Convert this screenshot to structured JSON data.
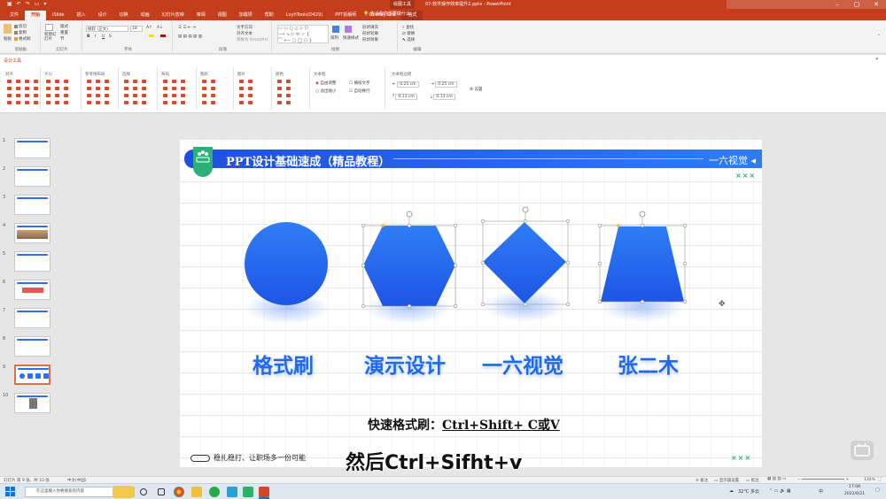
{
  "titlebar": {
    "context_tool": "绘图工具",
    "doc_title": "07-软件操作效率提升2.pptx  -  PowerPoint",
    "window_controls": [
      "minimize-icon",
      "restore-icon",
      "close-icon"
    ]
  },
  "tabs": [
    {
      "label": "文件",
      "active": false
    },
    {
      "label": "开始",
      "active": true
    },
    {
      "label": "iSlide",
      "active": false
    },
    {
      "label": "插入",
      "active": false
    },
    {
      "label": "设计",
      "active": false
    },
    {
      "label": "切换",
      "active": false
    },
    {
      "label": "动画",
      "active": false
    },
    {
      "label": "幻灯片放映",
      "active": false
    },
    {
      "label": "审阅",
      "active": false
    },
    {
      "label": "视图",
      "active": false
    },
    {
      "label": "加载项",
      "active": false
    },
    {
      "label": "帮助",
      "active": false
    },
    {
      "label": "LvyhTools(D429)",
      "active": false
    },
    {
      "label": "PPT拆解师",
      "active": false
    },
    {
      "label": "OneKey Lite",
      "active": false
    },
    {
      "label": "格式",
      "active": false,
      "contextual": true
    }
  ],
  "tell_me": "告诉我你想要做什么",
  "ribbon": {
    "clipboard": {
      "label": "剪贴板",
      "paste": "粘贴",
      "cut": "剪切",
      "copy": "复制",
      "format_painter": "格式刷"
    },
    "slides": {
      "label": "幻灯片",
      "new_slide": "新建幻灯片",
      "layout": "版式",
      "reset": "重置",
      "section": "节"
    },
    "font": {
      "label": "字体",
      "font_name": "微软 (正文)",
      "font_size": "18",
      "bold": "B",
      "italic": "I",
      "underline": "U",
      "strike": "S"
    },
    "paragraph": {
      "label": "段落",
      "text_direction": "文字方向",
      "align_text": "对齐文本",
      "smartart": "转换为 SmartArt"
    },
    "drawing": {
      "label": "绘图",
      "arrange": "排列",
      "quick_styles": "快速样式",
      "shape_fill": "形状填充",
      "shape_outline": "形状轮廓",
      "shape_effects": "形状效果"
    },
    "editing": {
      "label": "编辑",
      "find": "查找",
      "replace": "替换",
      "select": "选择"
    }
  },
  "design_pane": {
    "title": "设计工具",
    "groups": [
      {
        "title": "对齐"
      },
      {
        "title": "大小"
      },
      {
        "title": "参考线布局"
      },
      {
        "title": "选择"
      },
      {
        "title": "布局"
      },
      {
        "title": "图形"
      },
      {
        "title": "图片"
      },
      {
        "title": "颜色"
      }
    ],
    "text_group": {
      "title": "文本框",
      "autofit": "自由调整",
      "overflow": "溢出缩小",
      "vertical": "横排文字",
      "wrap": "自动换行"
    },
    "margins": {
      "title": "文本框边距",
      "left": "0.25 cm",
      "right": "0.25 cm",
      "top": "0.13 cm",
      "bottom": "0.13 cm",
      "settings": "设置"
    }
  },
  "thumbnails": [
    {
      "num": "1"
    },
    {
      "num": "2"
    },
    {
      "num": "3"
    },
    {
      "num": "4"
    },
    {
      "num": "5"
    },
    {
      "num": "6"
    },
    {
      "num": "7"
    },
    {
      "num": "8"
    },
    {
      "num": "9",
      "active": true
    },
    {
      "num": "10"
    }
  ],
  "slide": {
    "banner_title": "PPT设计基础速成（精品教程）",
    "banner_right": "一六视觉 ◂",
    "xxx_mark": "×××",
    "labels": [
      "格式刷",
      "演示设计",
      "一六视觉",
      "张二木"
    ],
    "shortcut_prefix": "快速格式刷：",
    "shortcut_keys": "Ctrl+Shift+ C或V",
    "footer_motto": "稳扎稳打、让职场多一份可能"
  },
  "subtitle": "然后Ctrl+Sifht+v",
  "statusbar": {
    "slide_info": "幻灯片 第 9 张，共 10 张",
    "language": "中文(中国)",
    "notes": "备注",
    "display_settings": "显示器设置",
    "comments": "批注",
    "zoom": "132%"
  },
  "taskbar": {
    "search_placeholder": "在这里输入你要搜索的内容",
    "weather": "32°C 多云",
    "ime": "中",
    "time": "17:08",
    "date": "2022/8/21"
  },
  "colors": {
    "accent": "#c43e1c",
    "shape_blue": "#2a74f0",
    "banner_blue": "#1e4fe0",
    "badge_green": "#2bb07a"
  }
}
